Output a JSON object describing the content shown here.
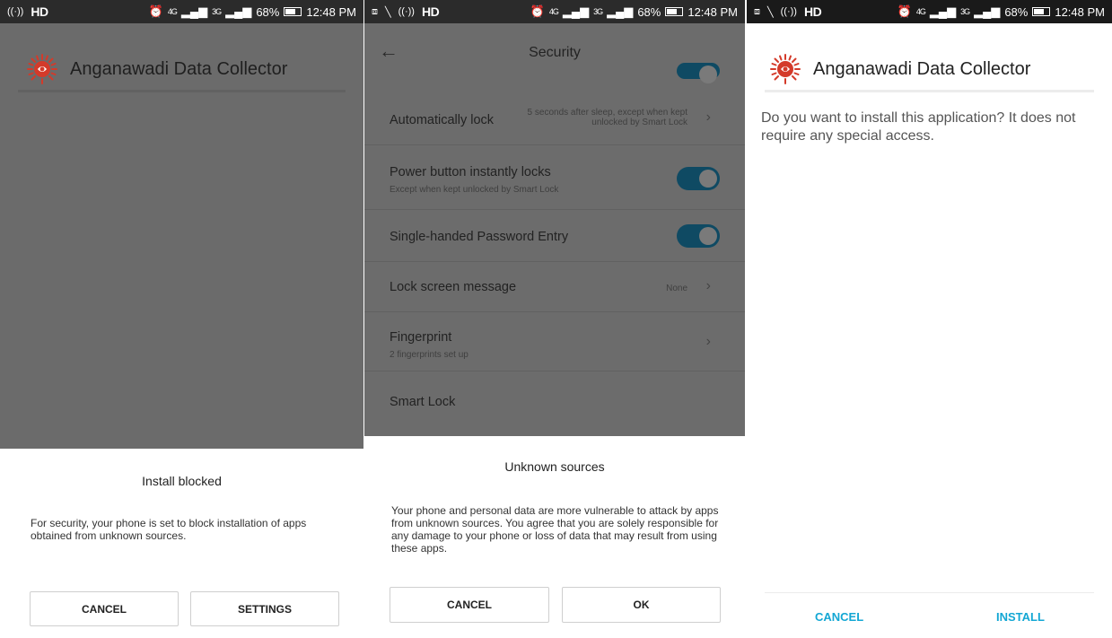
{
  "status_bar": {
    "battery": "68%",
    "time": "12:48 PM",
    "hd": "HD",
    "network_4g": "4G",
    "network_3g": "3G"
  },
  "install_blocked": {
    "app_title": "Anganawadi Data Collector",
    "dialog_title": "Install blocked",
    "message": "For security, your phone is set to block installation of apps obtained from unknown sources.",
    "cancel": "CANCEL",
    "settings": "SETTINGS"
  },
  "security": {
    "title": "Security",
    "rows": [
      {
        "label": "Automatically lock",
        "value": "5 seconds after sleep, except when kept unlocked by Smart Lock"
      },
      {
        "label": "Power button instantly locks",
        "sub": "Except when kept unlocked by Smart Lock"
      },
      {
        "label": "Single-handed Password Entry"
      },
      {
        "label": "Lock screen message",
        "value": "None"
      },
      {
        "label": "Fingerprint",
        "sub": "2 fingerprints set up"
      },
      {
        "label": "Smart Lock"
      }
    ],
    "dialog_title": "Unknown sources",
    "message": "Your phone and personal data are more vulnerable to attack by apps from unknown sources. You agree that you are solely responsible for any damage to your phone or loss of data that may result from using these apps.",
    "cancel": "CANCEL",
    "ok": "OK"
  },
  "install_app": {
    "app_title": "Anganawadi Data Collector",
    "question": "Do you want to install this application? It does not require any special access.",
    "cancel": "CANCEL",
    "install": "INSTALL"
  },
  "colors": {
    "accent": "#13a7d4",
    "toggle": "#0f4a63",
    "logo": "#d43a2a"
  }
}
